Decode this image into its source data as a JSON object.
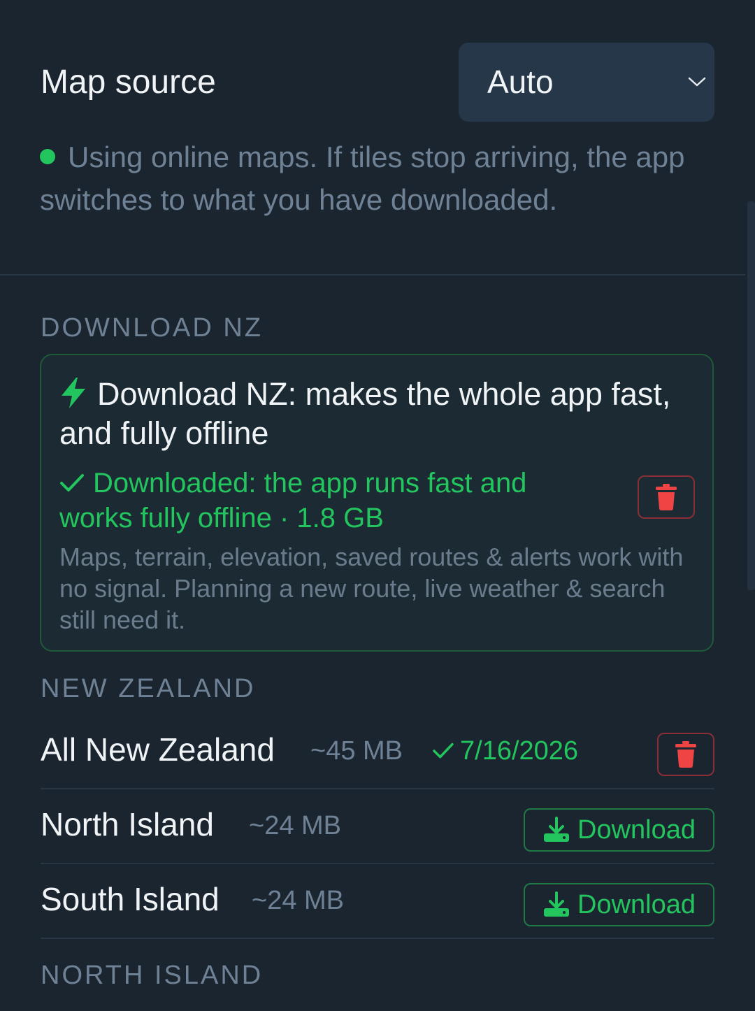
{
  "map_source": {
    "label": "Map source",
    "selected": "Auto",
    "status": "Using online maps. If tiles stop arriving, the app switches to what you have downloaded."
  },
  "download_nz": {
    "section_title": "DOWNLOAD NZ",
    "card_title": "Download NZ: makes the whole app fast, and fully offline",
    "status": "Downloaded: the app runs fast and works fully offline · 1.8 GB",
    "description": "Maps, terrain, elevation, saved routes & alerts work with no signal. Planning a new route, live weather & search still need it."
  },
  "new_zealand": {
    "section_title": "NEW ZEALAND",
    "regions": [
      {
        "name": "All New Zealand",
        "size": "~45 MB",
        "downloaded_date": "7/16/2026"
      },
      {
        "name": "North Island",
        "size": "~24 MB",
        "action_label": "Download"
      },
      {
        "name": "South Island",
        "size": "~24 MB",
        "action_label": "Download"
      }
    ]
  },
  "north_island": {
    "section_title": "NORTH ISLAND"
  },
  "colors": {
    "background": "#1b2530",
    "accent_green": "#22c55e",
    "danger_red": "#ef4444",
    "muted_text": "#6f8295"
  },
  "icons": [
    "chevron-down-icon",
    "status-dot-icon",
    "bolt-icon",
    "check-icon",
    "trash-icon",
    "download-icon"
  ]
}
